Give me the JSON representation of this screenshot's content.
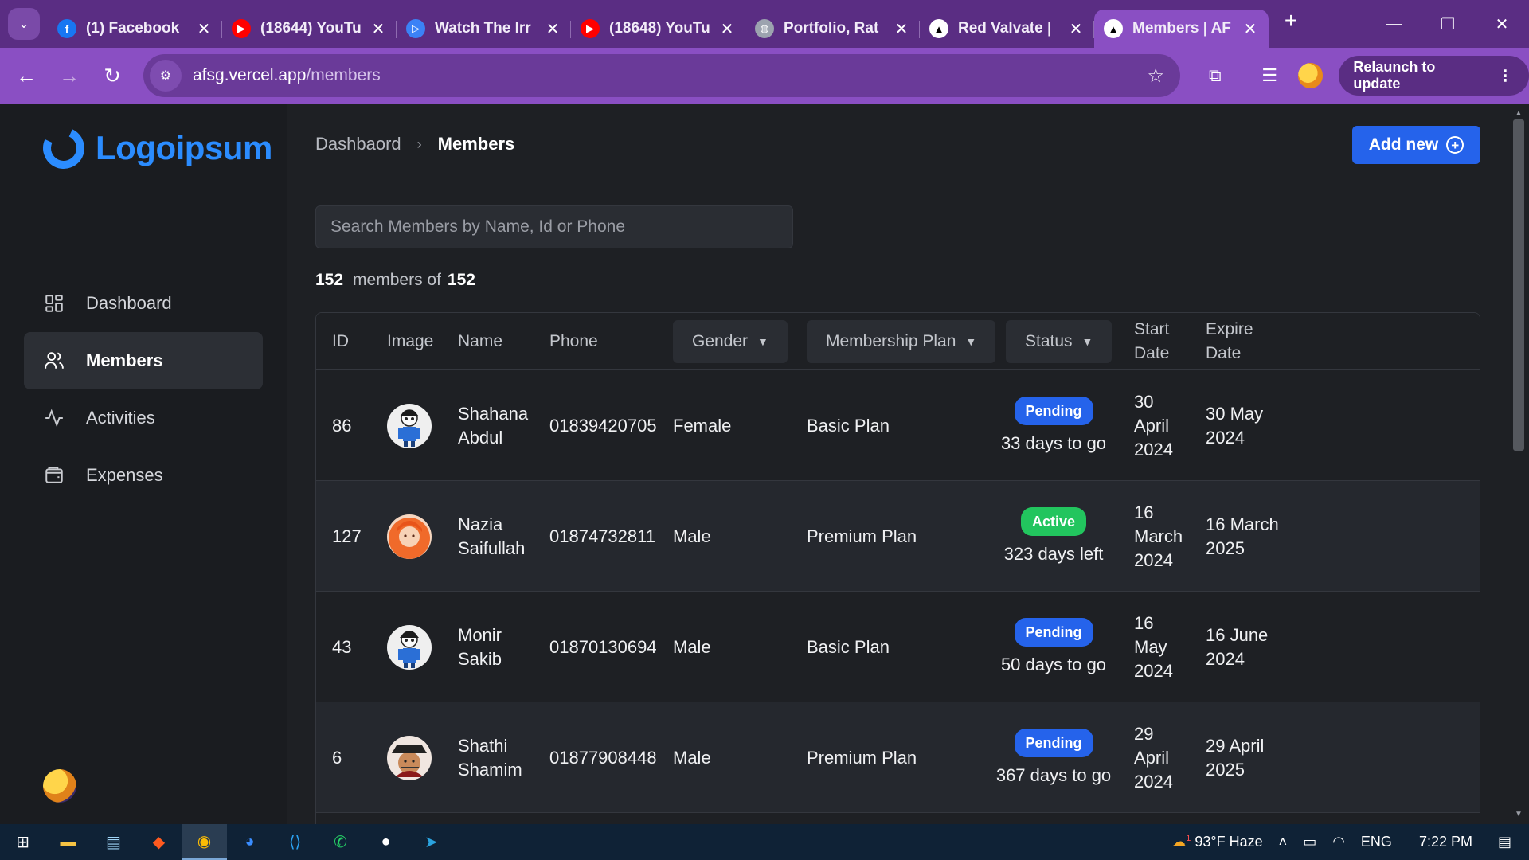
{
  "browser": {
    "tabs": [
      {
        "title": "(1) Facebook",
        "icon": "facebook-icon",
        "color": "#1877f2",
        "glyph": "f"
      },
      {
        "title": "(18644) YouTu",
        "icon": "youtube-icon",
        "color": "#ff0000",
        "glyph": "▶"
      },
      {
        "title": "Watch The Irr",
        "icon": "play-icon",
        "color": "#3b82f6",
        "glyph": "▷"
      },
      {
        "title": "(18648) YouTu",
        "icon": "youtube-icon",
        "color": "#ff0000",
        "glyph": "▶"
      },
      {
        "title": "Portfolio, Rat",
        "icon": "globe-icon",
        "color": "#9ca3af",
        "glyph": "◍"
      },
      {
        "title": "Red Valvate |",
        "icon": "vercel-icon",
        "color": "#000000",
        "glyph": "▲"
      },
      {
        "title": "Members | AF",
        "icon": "vercel-icon",
        "color": "#000000",
        "glyph": "▲"
      }
    ],
    "url_host": "afsg.vercel.app",
    "url_path": "/members",
    "relaunch_label": "Relaunch to update"
  },
  "sidebar": {
    "logo": "Logoipsum",
    "items": [
      {
        "label": "Dashboard",
        "icon": "dashboard-icon"
      },
      {
        "label": "Members",
        "icon": "users-icon"
      },
      {
        "label": "Activities",
        "icon": "activity-icon"
      },
      {
        "label": "Expenses",
        "icon": "wallet-icon"
      }
    ]
  },
  "header": {
    "breadcrumb_root": "Dashbaord",
    "breadcrumb_current": "Members",
    "add_new_label": "Add new"
  },
  "search": {
    "placeholder": "Search Members by Name, Id or Phone",
    "value": ""
  },
  "summary": {
    "shown": "152",
    "label": "members of",
    "total": "152"
  },
  "table": {
    "columns": {
      "id": "ID",
      "image": "Image",
      "name": "Name",
      "phone": "Phone",
      "gender": "Gender",
      "plan": "Membership Plan",
      "status": "Status",
      "start": "Start Date",
      "expire": "Expire Date"
    },
    "rows": [
      {
        "id": "86",
        "name": "Shahana Abdul",
        "phone": "01839420705",
        "gender": "Female",
        "plan": "Basic Plan",
        "status": "Pending",
        "status_color": "#2563eb",
        "days": "33 days to go",
        "start": "30 April 2024",
        "expire": "30 May 2024",
        "avatar": "skeleton-avatar"
      },
      {
        "id": "127",
        "name": "Nazia Saifullah",
        "phone": "01874732811",
        "gender": "Male",
        "plan": "Premium Plan",
        "status": "Active",
        "status_color": "#22c55e",
        "days": "323 days left",
        "start": "16 March 2024",
        "expire": "16 March 2025",
        "avatar": "orange-hair-avatar"
      },
      {
        "id": "43",
        "name": "Monir Sakib",
        "phone": "01870130694",
        "gender": "Male",
        "plan": "Basic Plan",
        "status": "Pending",
        "status_color": "#2563eb",
        "days": "50 days to go",
        "start": "16 May 2024",
        "expire": "16 June 2024",
        "avatar": "skeleton-avatar"
      },
      {
        "id": "6",
        "name": "Shathi Shamim",
        "phone": "01877908448",
        "gender": "Male",
        "plan": "Premium Plan",
        "status": "Pending",
        "status_color": "#2563eb",
        "days": "367 days to go",
        "start": "29 April 2024",
        "expire": "29 April 2025",
        "avatar": "pirate-avatar"
      }
    ]
  },
  "taskbar": {
    "weather_temp": "93°F",
    "weather_desc": "Haze",
    "weather_badge": "1",
    "language": "ENG",
    "time": "7:22 PM"
  },
  "colors": {
    "accent": "#2563eb",
    "brand": "#2b8cff",
    "chrome": "#8a4fc3",
    "success": "#22c55e"
  }
}
